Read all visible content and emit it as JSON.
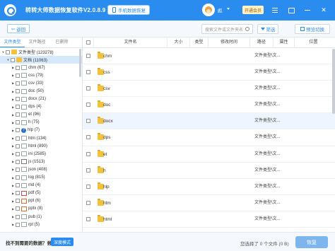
{
  "app": {
    "title": "转转大师数据恢复软件V2.0.8.9",
    "phone_recovery_label": "手机数据恢复",
    "username": "彪",
    "vip_label": "开通会员"
  },
  "toolbar": {
    "back_label": "返回",
    "search_placeholder": "搜索文件或文件夹名",
    "filter_label": "筛选",
    "view_label": "预览切换"
  },
  "left_tabs": [
    {
      "label": "文件类型",
      "active": true
    },
    {
      "label": "文件路径",
      "active": false
    },
    {
      "label": "已删除",
      "active": false
    }
  ],
  "tree": [
    {
      "label": "文件类型 (123278)",
      "level": 0,
      "icon": "folder-icon"
    },
    {
      "label": "文档 (11063)",
      "level": 1,
      "icon": "folder-icon",
      "selected": true
    },
    {
      "label": "chm (67)",
      "level": 2,
      "icon": "doc-icon"
    },
    {
      "label": "css (79)",
      "level": 2,
      "icon": "doc-icon"
    },
    {
      "label": "csv (33)",
      "level": 2,
      "icon": "doc-icon"
    },
    {
      "label": "doc (50)",
      "level": 2,
      "icon": "doc-icon"
    },
    {
      "label": "docx (21)",
      "level": 2,
      "icon": "doc-icon"
    },
    {
      "label": "dps (4)",
      "level": 2,
      "icon": "doc-icon"
    },
    {
      "label": "et (96)",
      "level": 2,
      "icon": "doc-icon"
    },
    {
      "label": "h (75)",
      "level": 2,
      "icon": "doc-icon"
    },
    {
      "label": "hlp (7)",
      "level": 2,
      "icon": "help-icon"
    },
    {
      "label": "htm (134)",
      "level": 2,
      "icon": "doc-icon"
    },
    {
      "label": "html (890)",
      "level": 2,
      "icon": "doc-icon"
    },
    {
      "label": "ini (2585)",
      "level": 2,
      "icon": "doc-icon"
    },
    {
      "label": "js (1513)",
      "level": 2,
      "icon": "js-icon"
    },
    {
      "label": "json (408)",
      "level": 2,
      "icon": "doc-icon"
    },
    {
      "label": "log (815)",
      "level": 2,
      "icon": "doc-icon"
    },
    {
      "label": "md (4)",
      "level": 2,
      "icon": "doc-icon"
    },
    {
      "label": "pdf (5)",
      "level": 2,
      "icon": "pdf-icon"
    },
    {
      "label": "ppt (6)",
      "level": 2,
      "icon": "ppt-icon"
    },
    {
      "label": "pptx (8)",
      "level": 2,
      "icon": "ppt-icon"
    },
    {
      "label": "pub (1)",
      "level": 2,
      "icon": "doc-icon"
    },
    {
      "label": "rpt (5)",
      "level": 2,
      "icon": "doc-icon"
    }
  ],
  "table": {
    "headers": [
      "文件名",
      "大小",
      "类型",
      "修改时间",
      "路径",
      "属性",
      "位置"
    ],
    "rows": [
      {
        "name": "chm",
        "path": "文件类型\\文..."
      },
      {
        "name": "css",
        "path": "文件类型\\文..."
      },
      {
        "name": "csv",
        "path": "文件类型\\文..."
      },
      {
        "name": "doc",
        "path": "文件类型\\文..."
      },
      {
        "name": "docx",
        "path": "文件类型\\文...",
        "highlighted": true
      },
      {
        "name": "dps",
        "path": "文件类型\\文..."
      },
      {
        "name": "et",
        "path": "文件类型\\文..."
      },
      {
        "name": "h",
        "path": "文件类型\\文..."
      },
      {
        "name": "hlp",
        "path": "文件类型\\文..."
      },
      {
        "name": "htm",
        "path": "文件类型\\文..."
      },
      {
        "name": "html",
        "path": "文件类型\\文..."
      }
    ]
  },
  "bottom": {
    "missing_text": "找不到需要的数据？尝试",
    "deep_scan_label": "深度模式",
    "selected_info": "您选择了 0 个文件 (0 B)",
    "recover_label": "恢复"
  },
  "colors": {
    "primary": "#2b8cf0",
    "folder": "#f3c23c",
    "recover_disabled": "#7db5ee"
  }
}
